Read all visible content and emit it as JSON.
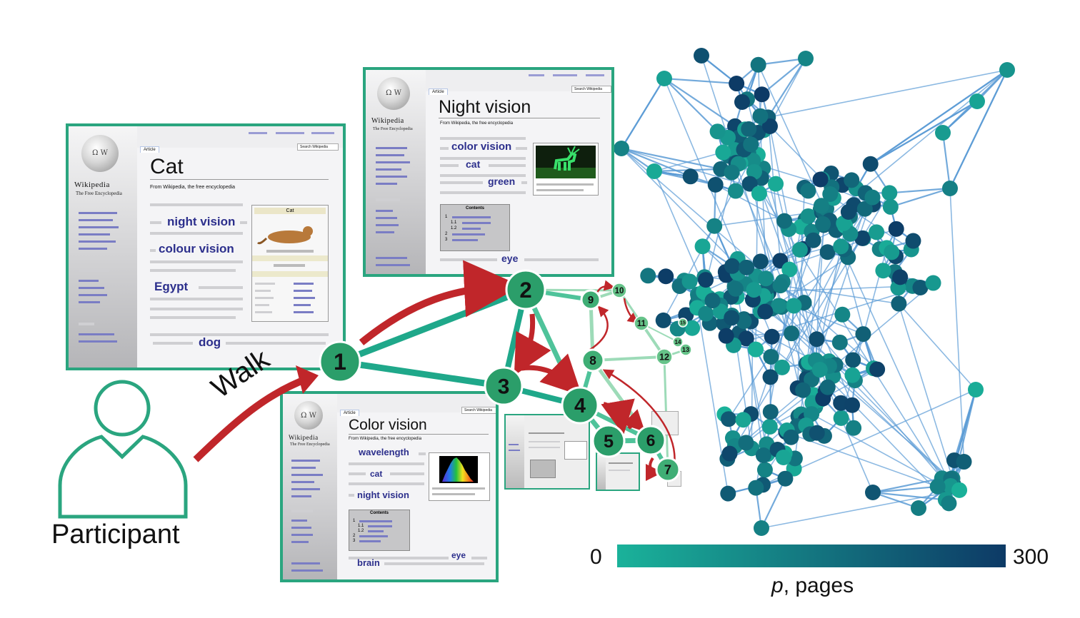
{
  "participant_label": "Participant",
  "walk_label": "Walk",
  "wiki_brand": {
    "name": "Wikipedia",
    "tagline": "The Free Encyclopedia"
  },
  "wiki_chrome": {
    "tab": "Article",
    "search": "Search Wikipedia",
    "from": "From Wikipedia, the free encyclopedia",
    "contents": "Contents"
  },
  "pages": {
    "cat": {
      "title": "Cat",
      "links": [
        "night vision",
        "colour vision",
        "Egypt",
        "dog"
      ],
      "infobox_title": "Cat"
    },
    "night_vision": {
      "title": "Night vision",
      "links": [
        "color vision",
        "cat",
        "green",
        "eye"
      ]
    },
    "color_vision": {
      "title": "Color vision",
      "links": [
        "wavelength",
        "cat",
        "night vision",
        "eye",
        "brain"
      ]
    }
  },
  "toc_items": [
    "1",
    "1.1",
    "1.2",
    "2",
    "3"
  ],
  "walk_nodes": [
    "1",
    "2",
    "3",
    "4",
    "5",
    "6",
    "7",
    "8",
    "9",
    "10",
    "11",
    "12",
    "13",
    "14",
    "15"
  ],
  "colorbar": {
    "min": "0",
    "max": "300",
    "label_var": "p",
    "label_rest": ", pages",
    "color_low": "#1ab29a",
    "color_high": "#0d3a66"
  },
  "colors": {
    "accent_green": "#2aa57f",
    "walk_arrow": "#c0262a",
    "network_edge": "#5b9bd5"
  }
}
